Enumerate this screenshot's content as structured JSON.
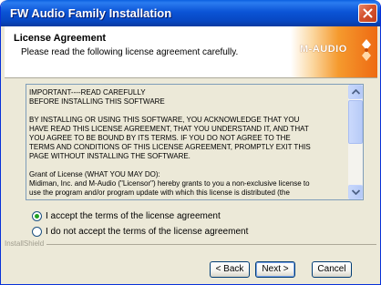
{
  "window": {
    "title": "FW Audio Family Installation"
  },
  "header": {
    "title": "License Agreement",
    "subtitle": "Please read the following license agreement carefully.",
    "logo_text": "M-AUDIO"
  },
  "license": {
    "paragraphs": [
      "IMPORTANT----READ CAREFULLY\nBEFORE INSTALLING THIS SOFTWARE",
      "BY INSTALLING OR USING THIS SOFTWARE, YOU ACKNOWLEDGE THAT YOU\nHAVE READ THIS LICENSE AGREEMENT, THAT YOU UNDERSTAND IT, AND THAT\nYOU AGREE TO BE BOUND BY ITS TERMS.  IF YOU DO NOT AGREE TO THE\nTERMS AND CONDITIONS OF THIS LICENSE AGREEMENT, PROMPTLY EXIT THIS\nPAGE WITHOUT INSTALLING THE SOFTWARE.",
      "Grant of License  (WHAT YOU MAY DO):\nMidiman, Inc. and M-Audio  (\"Licensor\") hereby grants to you a non-exclusive license to\nuse the program and/or program update with which this license is distributed (the"
    ]
  },
  "options": {
    "accept": "I accept the terms of the license agreement",
    "decline": "I do not accept the terms of the license agreement",
    "selected": "accept"
  },
  "footer": {
    "brand": "InstallShield",
    "back_label": "< Back",
    "next_label": "Next >",
    "cancel_label": "Cancel"
  }
}
